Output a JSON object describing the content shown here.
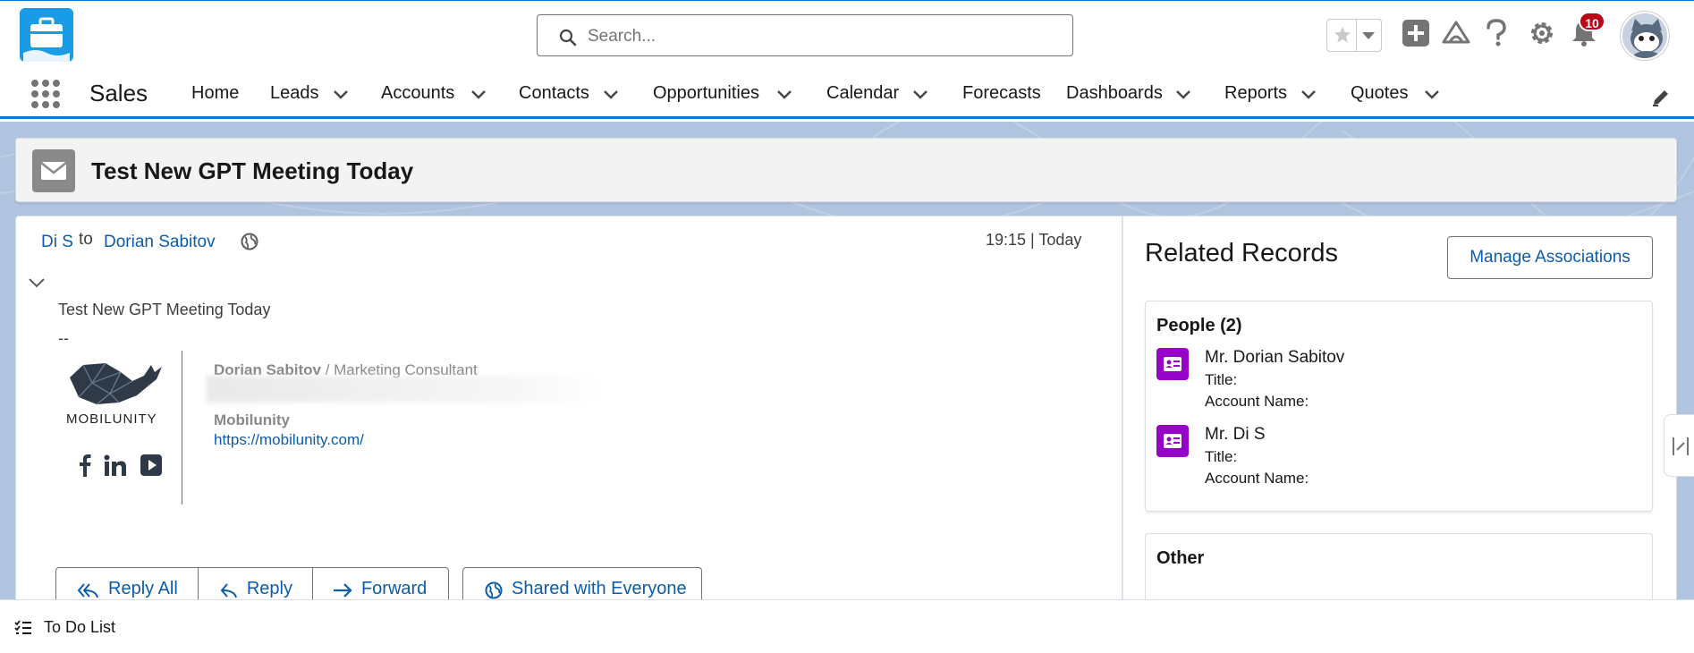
{
  "header": {
    "search_placeholder": "Search...",
    "notification_count": "10",
    "icons": [
      "search-icon",
      "star-icon",
      "chevron-down-icon",
      "plus-icon",
      "trailhead-icon",
      "help-icon",
      "gear-icon",
      "bell-icon"
    ]
  },
  "nav": {
    "app_name": "Sales",
    "items": [
      {
        "label": "Home",
        "has_menu": false
      },
      {
        "label": "Leads",
        "has_menu": true
      },
      {
        "label": "Accounts",
        "has_menu": true
      },
      {
        "label": "Contacts",
        "has_menu": true
      },
      {
        "label": "Opportunities",
        "has_menu": true
      },
      {
        "label": "Calendar",
        "has_menu": true
      },
      {
        "label": "Forecasts",
        "has_menu": false
      },
      {
        "label": "Dashboards",
        "has_menu": true
      },
      {
        "label": "Reports",
        "has_menu": true
      },
      {
        "label": "Quotes",
        "has_menu": true
      }
    ]
  },
  "record": {
    "title": "Test New GPT Meeting Today"
  },
  "email": {
    "from": "Di S",
    "to_word": "to",
    "to": "Dorian Sabitov",
    "timestamp": "19:15 | Today",
    "subject_line": "Test New GPT Meeting Today",
    "separator": "--",
    "signature": {
      "name": "Dorian Sabitov",
      "slash": " / ",
      "title": "Marketing Consultant",
      "logo_text": "MOBILUNITY",
      "company": "Mobilunity",
      "url": "https://mobilunity.com/"
    },
    "buttons": {
      "reply_all": "Reply All",
      "reply": "Reply",
      "forward": "Forward",
      "shared": "Shared with Everyone"
    }
  },
  "related": {
    "title": "Related Records",
    "manage_label": "Manage Associations",
    "people_title": "People (2)",
    "people": [
      {
        "name": "Mr. Dorian Sabitov",
        "title_label": "Title:",
        "account_label": "Account Name:"
      },
      {
        "name": "Mr. Di S",
        "title_label": "Title:",
        "account_label": "Account Name:"
      }
    ],
    "other_title": "Other"
  },
  "footer": {
    "todo_label": "To Do List"
  },
  "colors": {
    "brand_blue": "#0176d3",
    "link_blue": "#0b5cab",
    "contact_purple": "#9602c7",
    "badge_red": "#ba0517",
    "content_bg": "#b0c4df"
  }
}
